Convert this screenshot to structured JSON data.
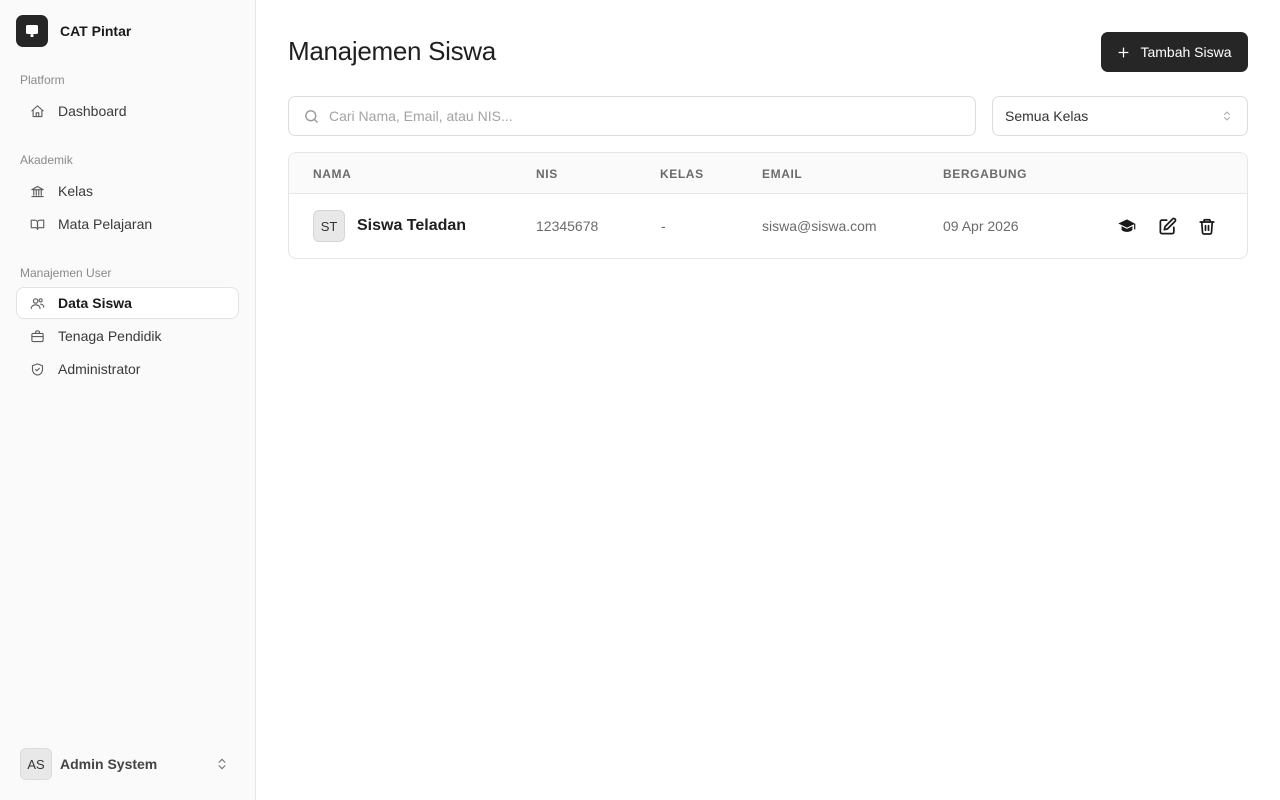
{
  "app": {
    "name": "CAT Pintar"
  },
  "sidebar": {
    "groups": [
      {
        "label": "Platform",
        "items": [
          {
            "label": "Dashboard",
            "icon": "home-icon"
          }
        ]
      },
      {
        "label": "Akademik",
        "items": [
          {
            "label": "Kelas",
            "icon": "building-icon"
          },
          {
            "label": "Mata Pelajaran",
            "icon": "book-icon"
          }
        ]
      },
      {
        "label": "Manajemen User",
        "items": [
          {
            "label": "Data Siswa",
            "icon": "users-icon",
            "active": true
          },
          {
            "label": "Tenaga Pendidik",
            "icon": "briefcase-icon"
          },
          {
            "label": "Administrator",
            "icon": "shield-icon"
          }
        ]
      }
    ],
    "user": {
      "initials": "AS",
      "name": "Admin System"
    }
  },
  "main": {
    "title": "Manajemen Siswa",
    "add_button": "Tambah Siswa",
    "search": {
      "placeholder": "Cari Nama, Email, atau NIS...",
      "value": ""
    },
    "class_filter": {
      "selected": "Semua Kelas"
    },
    "table": {
      "columns": [
        "NAMA",
        "NIS",
        "KELAS",
        "EMAIL",
        "BERGABUNG"
      ],
      "rows": [
        {
          "initials": "ST",
          "name": "Siswa Teladan",
          "nis": "12345678",
          "kelas": "-",
          "email": "siswa@siswa.com",
          "joined": "09 Apr 2026",
          "actions": [
            "graduation-cap-icon",
            "edit-icon",
            "trash-icon"
          ]
        }
      ]
    }
  },
  "colors": {
    "primary": "#262626",
    "sidebar_bg": "#fafafa",
    "border": "#e6e6e6"
  }
}
